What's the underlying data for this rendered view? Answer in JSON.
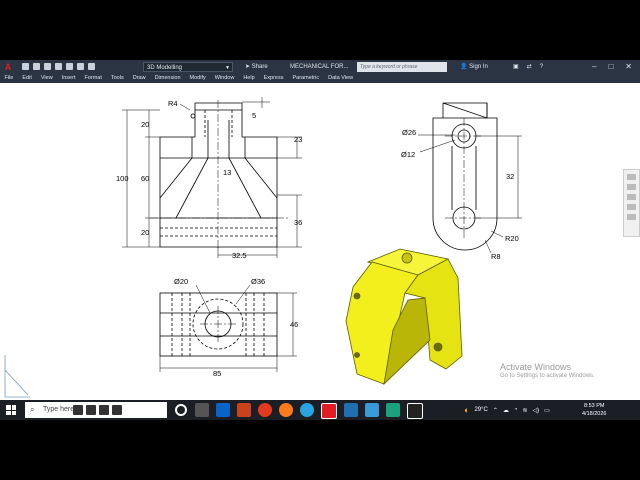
{
  "titlebar": {
    "logo": "A",
    "workspace": "3D Modelling",
    "share": "Share",
    "document_title": "MECHANICAL FOR...",
    "search_placeholder": "Type a keyword or phrase",
    "sign_in": "Sign In"
  },
  "menu": [
    "File",
    "Edit",
    "View",
    "Insert",
    "Format",
    "Tools",
    "Draw",
    "Dimension",
    "Modify",
    "Window",
    "Help",
    "Express",
    "Parametric",
    "Data View"
  ],
  "drawing": {
    "front_view": {
      "r4": "R4",
      "d5": "5",
      "d20_top": "20",
      "d60": "60",
      "d100": "100",
      "d20_bot": "20",
      "d23": "23",
      "d13": "13",
      "d36": "36",
      "d32_5": "32.5"
    },
    "side_view": {
      "d26": "Ø26",
      "d12": "Ø12",
      "d32": "32",
      "r20": "R20",
      "r8": "R8"
    },
    "top_view": {
      "d20": "Ø20",
      "d36": "Ø36",
      "d46": "46",
      "d85": "85"
    },
    "colors": {
      "model_yellow": "#f2ef1d",
      "model_edge": "#5a5a00",
      "line": "#000000"
    }
  },
  "watermark": {
    "title": "Activate Windows",
    "subtitle": "Go to Settings to activate Windows."
  },
  "taskbar": {
    "search_text": "Type here",
    "weather": "29°C",
    "time": "8:53 PM",
    "date": "4/18/2026"
  }
}
